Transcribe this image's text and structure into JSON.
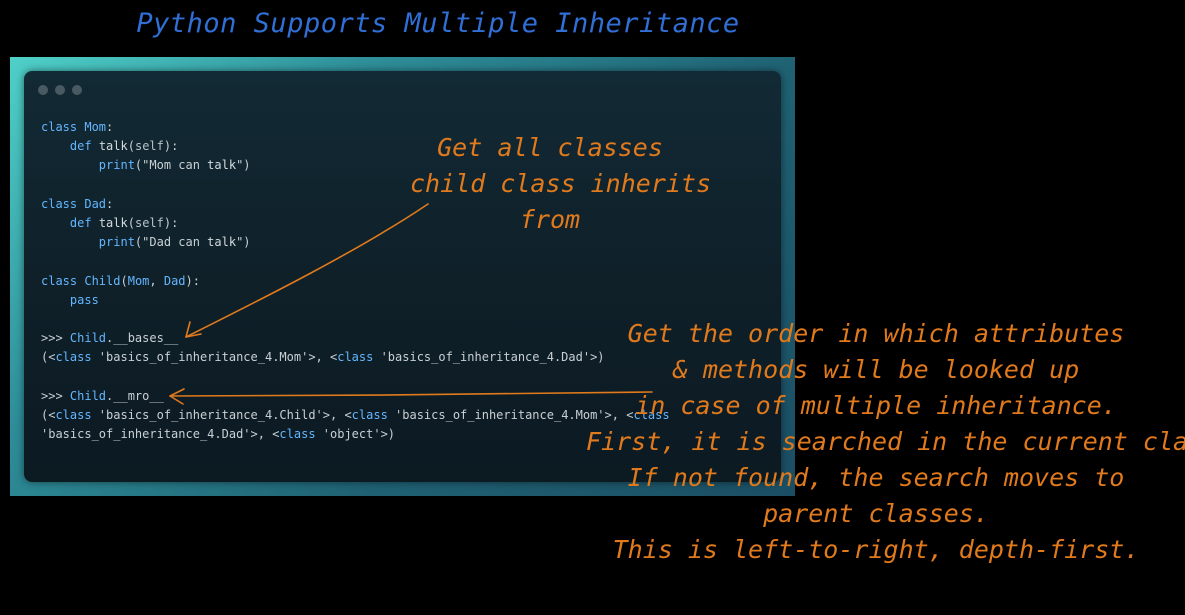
{
  "title": "Python Supports Multiple Inheritance",
  "colors": {
    "title": "#2f6fd6",
    "annotation": "#e07a1c",
    "keyword": "#63b6ff",
    "code_text": "#c8d0d4"
  },
  "code": {
    "lines": [
      "class Mom:",
      "    def talk(self):",
      "        print(\"Mom can talk\")",
      "",
      "class Dad:",
      "    def talk(self):",
      "        print(\"Dad can talk\")",
      "",
      "class Child(Mom, Dad):",
      "    pass",
      "",
      ">>> Child.__bases__",
      "(<class 'basics_of_inheritance_4.Mom'>, <class 'basics_of_inheritance_4.Dad'>)",
      "",
      ">>> Child.__mro__",
      "(<class 'basics_of_inheritance_4.Child'>, <class 'basics_of_inheritance_4.Mom'>, <class",
      "'basics_of_inheritance_4.Dad'>, <class 'object'>)"
    ]
  },
  "annotations": {
    "bases": {
      "lines": [
        "Get all classes",
        "child class inherits",
        "from"
      ]
    },
    "mro": {
      "lines": [
        "Get the order in which attributes",
        "& methods will be looked up",
        "in case of multiple inheritance.",
        "First, it is searched in the current class.",
        "If not found, the search moves to",
        "parent classes.",
        "This is left-to-right, depth-first."
      ]
    }
  }
}
